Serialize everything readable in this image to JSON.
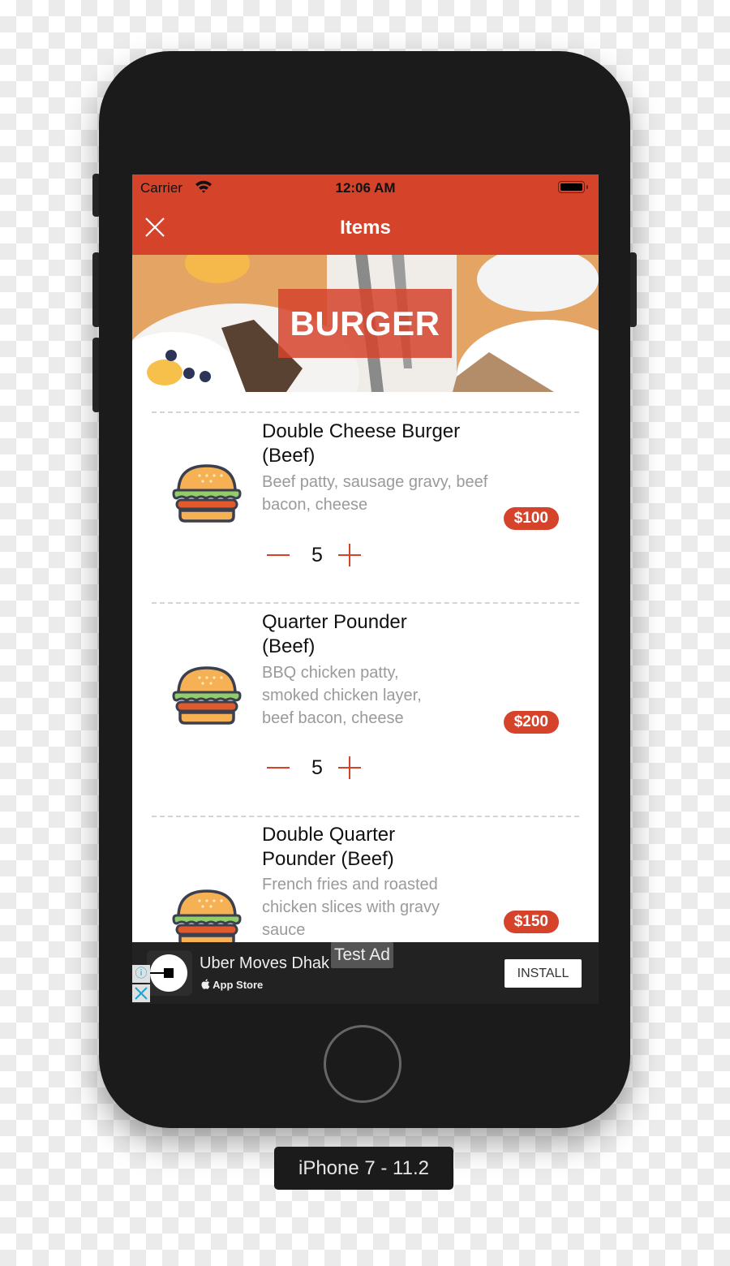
{
  "status_bar": {
    "carrier": "Carrier",
    "time": "12:06 AM",
    "wifi_icon": "wifi-icon",
    "battery_icon": "battery-full-icon"
  },
  "nav": {
    "title": "Items",
    "close_icon": "close-icon"
  },
  "hero": {
    "category": "BURGER"
  },
  "items": [
    {
      "name": "Double Cheese Burger (Beef)",
      "description": "Beef patty, sausage gravy, beef bacon, cheese",
      "price": "$100",
      "quantity": "5",
      "icon": "burger-icon"
    },
    {
      "name": "Quarter Pounder (Beef)",
      "description": "BBQ chicken patty, smoked chicken layer, beef bacon, cheese",
      "price": "$200",
      "quantity": "5",
      "icon": "burger-icon"
    },
    {
      "name": "Double Quarter Pounder (Beef)",
      "description": "French fries and roasted chicken slices with gravy sauce",
      "price": "$150",
      "icon": "burger-icon"
    }
  ],
  "ad": {
    "app_name": "Uber Moves Dhak",
    "store": "App Store",
    "badge": "Test Ad",
    "install_label": "INSTALL",
    "info_icon": "ⓘ"
  },
  "device_label": "iPhone 7 - 11.2",
  "colors": {
    "accent": "#d5432b",
    "phone_body": "#1b1b1b"
  }
}
